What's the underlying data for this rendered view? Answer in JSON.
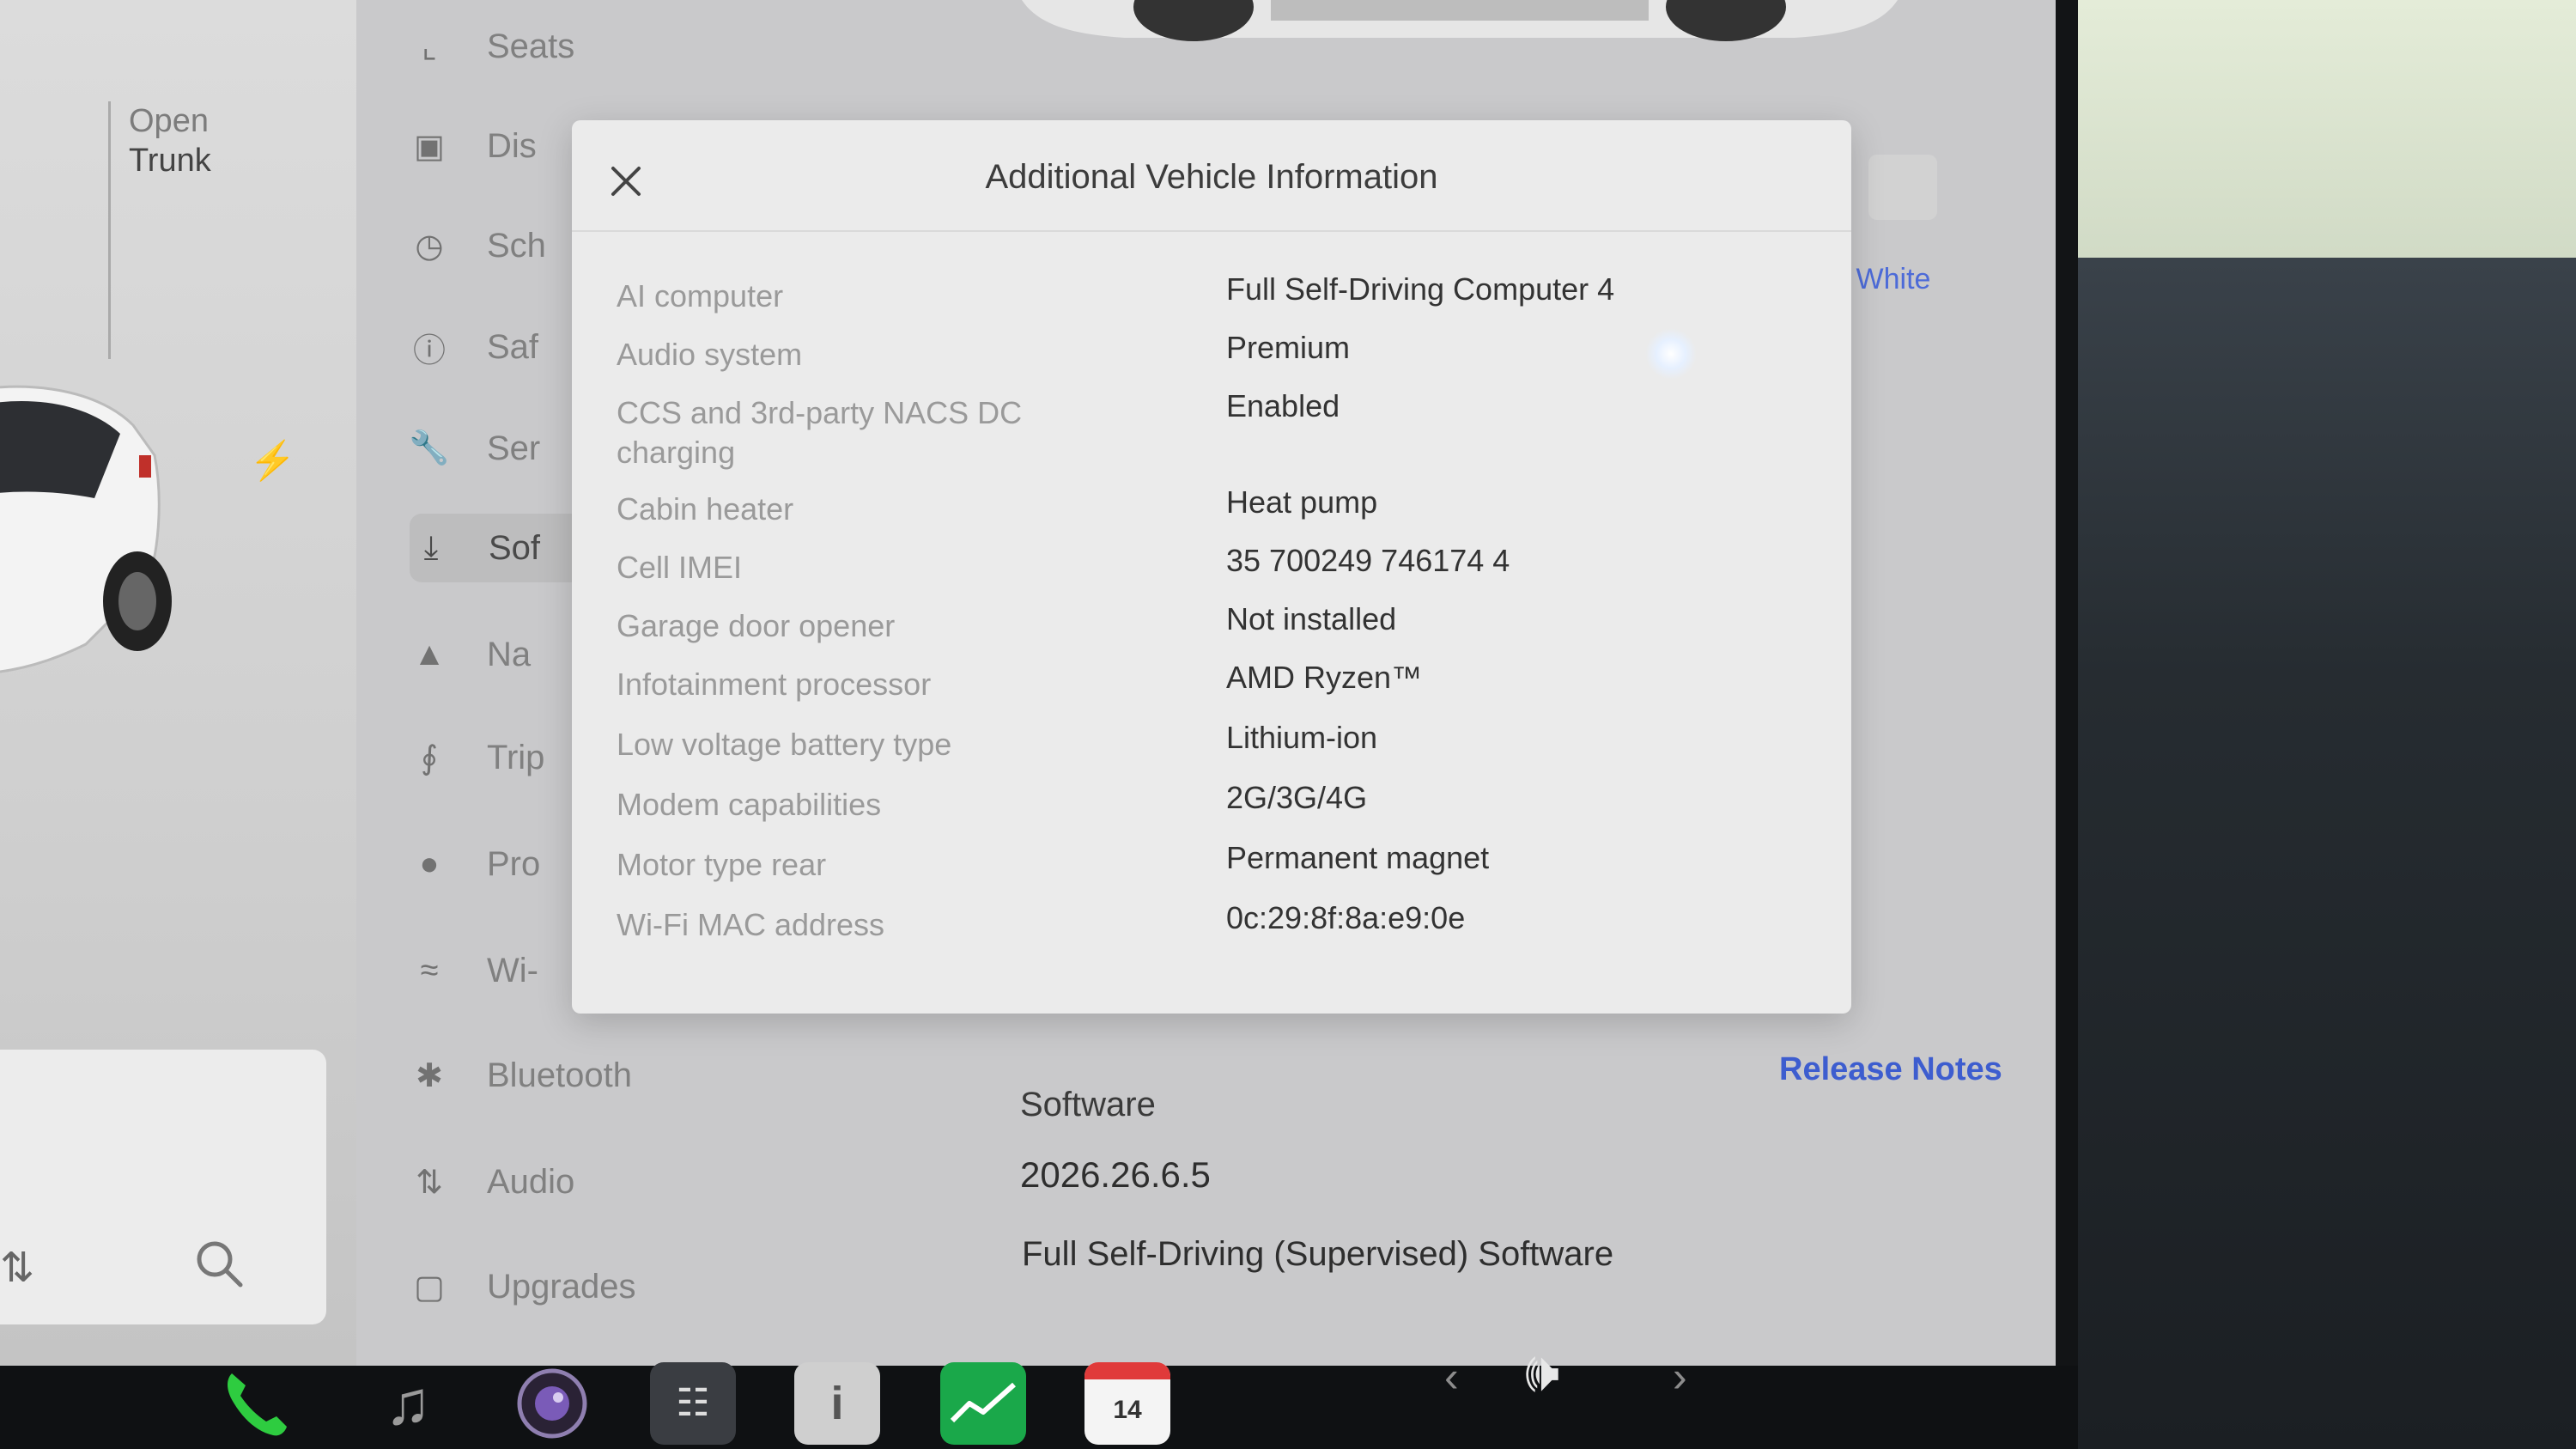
{
  "left_panel": {
    "trunk_action": "Open",
    "trunk_target": "Trunk"
  },
  "menu": {
    "items": [
      {
        "icon": "seat-icon",
        "label": "Seats"
      },
      {
        "icon": "display-icon",
        "label": "Dis"
      },
      {
        "icon": "schedule-icon",
        "label": "Sch"
      },
      {
        "icon": "safety-icon",
        "label": "Saf"
      },
      {
        "icon": "wrench-icon",
        "label": "Ser"
      },
      {
        "icon": "download-icon",
        "label": "Sof"
      },
      {
        "icon": "navigation-icon",
        "label": "Na"
      },
      {
        "icon": "trips-icon",
        "label": "Trip"
      },
      {
        "icon": "profile-icon",
        "label": "Pro"
      },
      {
        "icon": "wifi-icon",
        "label": "Wi-"
      },
      {
        "icon": "bluetooth-icon",
        "label": "Bluetooth"
      },
      {
        "icon": "audio-icon",
        "label": "Audio"
      },
      {
        "icon": "lock-icon",
        "label": "Upgrades"
      }
    ],
    "active_index": 5
  },
  "software_page": {
    "color_label": "Y White",
    "release_notes_link": "Release Notes",
    "heading": "Software",
    "version": "2026.26.6.5",
    "package": "Full Self-Driving (Supervised) Software"
  },
  "modal": {
    "title": "Additional Vehicle Information",
    "rows": [
      {
        "key": "AI computer",
        "value": "Full Self-Driving Computer 4"
      },
      {
        "key": "Audio system",
        "value": "Premium"
      },
      {
        "key": "CCS and 3rd-party NACS DC charging",
        "value": "Enabled"
      },
      {
        "key": "Cabin heater",
        "value": "Heat pump"
      },
      {
        "key": "Cell IMEI",
        "value": "35 700249 746174 4"
      },
      {
        "key": "Garage door opener",
        "value": "Not installed"
      },
      {
        "key": "Infotainment processor",
        "value": "AMD Ryzen™"
      },
      {
        "key": "Low voltage battery type",
        "value": "Lithium-ion"
      },
      {
        "key": "Modem capabilities",
        "value": "2G/3G/4G"
      },
      {
        "key": "Motor type rear",
        "value": "Permanent magnet"
      },
      {
        "key": "Wi-Fi MAC address",
        "value": "0c:29:8f:8a:e9:0e"
      }
    ]
  },
  "dock": {
    "calendar_day": "14",
    "apps": [
      "phone-icon",
      "music-icon",
      "camera-icon",
      "toybox-icon",
      "manual-icon",
      "stocks-icon",
      "calendar-icon"
    ]
  },
  "colors": {
    "link": "#3d5dcf",
    "screen_bg": "#c9c9cb",
    "modal_bg": "#ebebeb",
    "phone_green": "#2ecc40",
    "stocks_green": "#1aa84a",
    "calendar_red": "#e03a3a"
  }
}
